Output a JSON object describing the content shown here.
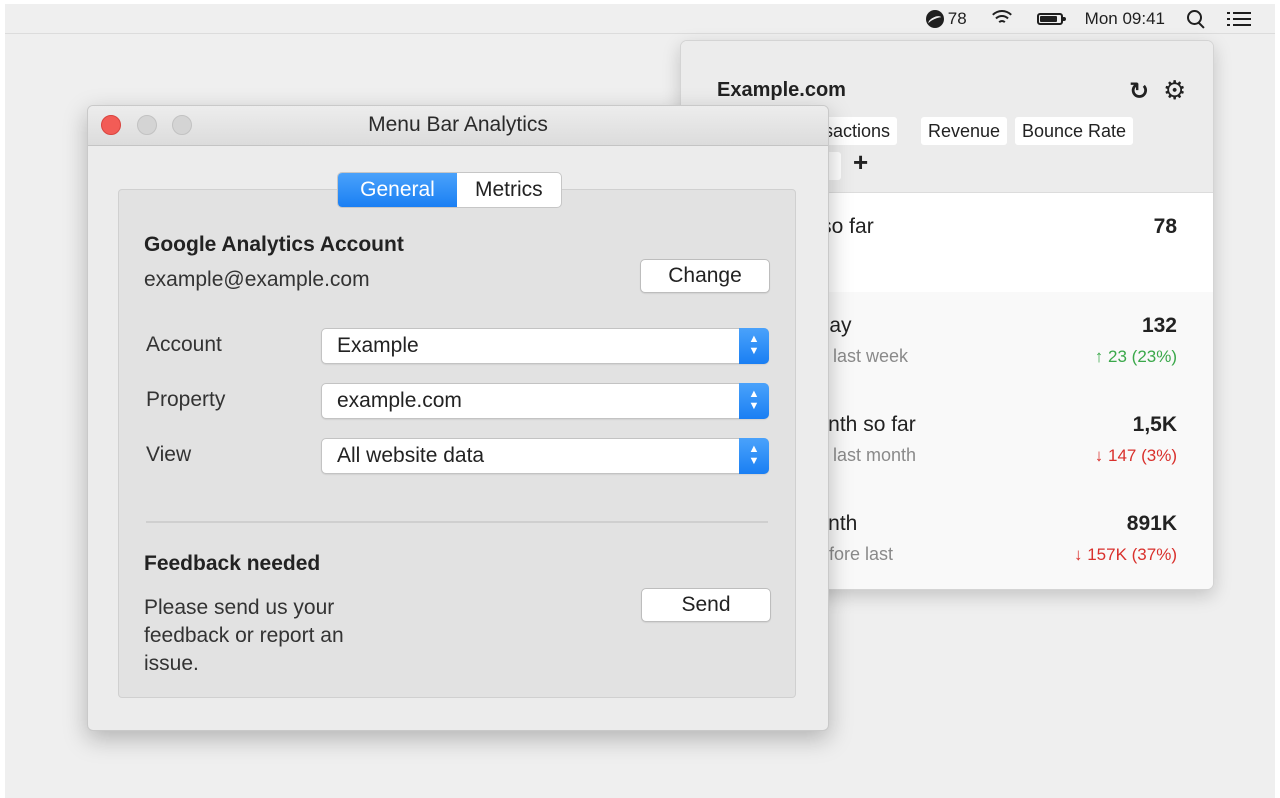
{
  "menubar": {
    "app_count": "78",
    "clock": "Mon 09:41",
    "icons": [
      "analytics-logo-icon",
      "wifi-icon",
      "battery-icon",
      "search-icon",
      "list-icon"
    ]
  },
  "popover": {
    "title": "Example.com",
    "chips": [
      "nsactions",
      "Revenue",
      "Bounce Rate"
    ],
    "add_label": "+",
    "metrics": [
      {
        "label": "ıy so far",
        "sub": "",
        "value": "78",
        "delta": ""
      },
      {
        "label": "erday",
        "sub": "day last week",
        "value": "132",
        "delta": "↑ 23 (23%)",
        "trend": "up"
      },
      {
        "label": "month so far",
        "sub": "day last month",
        "value": "1,5K",
        "delta": "↓ 147 (3%)",
        "trend": "down"
      },
      {
        "label": "month",
        "sub": "ı before last",
        "value": "891K",
        "delta": "↓ 157K (37%)",
        "trend": "down"
      }
    ]
  },
  "window": {
    "title": "Menu Bar Analytics",
    "tabs": [
      {
        "label": "General",
        "active": true
      },
      {
        "label": "Metrics",
        "active": false
      }
    ],
    "account_section": {
      "title": "Google Analytics Account",
      "email": "example@example.com",
      "change_label": "Change"
    },
    "fields": [
      {
        "label": "Account",
        "value": "Example"
      },
      {
        "label": "Property",
        "value": "example.com"
      },
      {
        "label": "View",
        "value": "All website data"
      }
    ],
    "feedback": {
      "title": "Feedback needed",
      "text": "Please send us your feedback or report an issue.",
      "send_label": "Send"
    }
  },
  "colors": {
    "accent": "#1a7ff3",
    "close": "#f25c56",
    "up": "#3aa84a",
    "down": "#d9302c"
  }
}
